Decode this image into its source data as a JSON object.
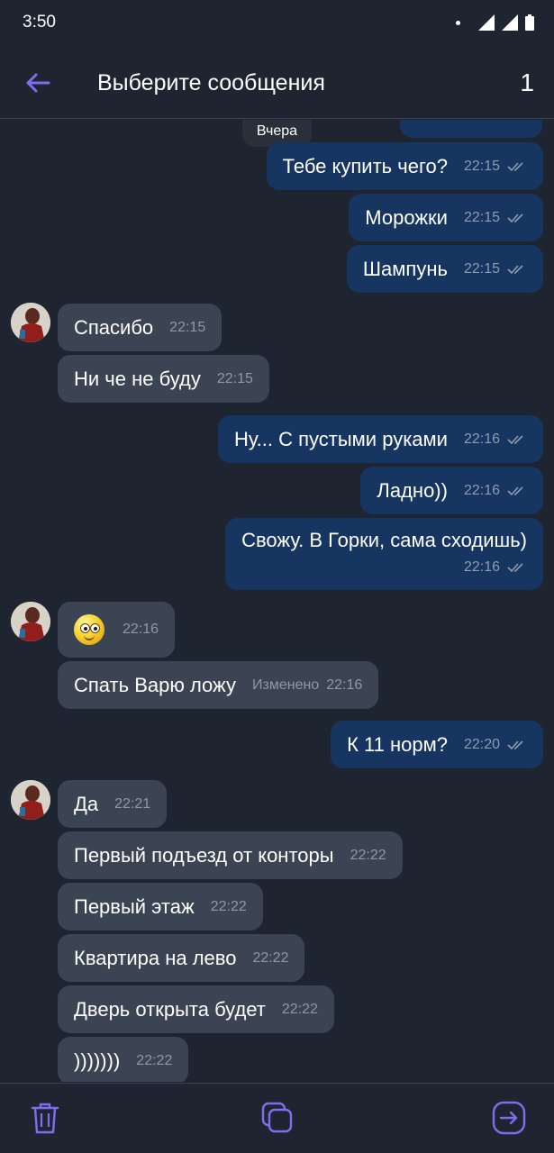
{
  "status_bar": {
    "time": "3:50"
  },
  "app_bar": {
    "title": "Выберите сообщения",
    "selected_count": "1"
  },
  "date_chip": "Вчера",
  "messages": [
    {
      "dir": "out",
      "text": "Тебе купить чего?",
      "time": "22:15"
    },
    {
      "dir": "out",
      "text": "Морожки",
      "time": "22:15"
    },
    {
      "dir": "out",
      "text": "Шампунь",
      "time": "22:15"
    },
    {
      "dir": "in",
      "text": "Спасибо",
      "time": "22:15"
    },
    {
      "dir": "in",
      "text": "Ни че не буду",
      "time": "22:15"
    },
    {
      "dir": "out",
      "text": "Ну... С пустыми руками",
      "time": "22:16"
    },
    {
      "dir": "out",
      "text": "Ладно))",
      "time": "22:16"
    },
    {
      "dir": "out",
      "text": "Свожу. В Горки, сама сходишь)",
      "time": "22:16"
    },
    {
      "dir": "in",
      "emoji": "smiley",
      "time": "22:16"
    },
    {
      "dir": "in",
      "text": "Спать Варю ложу",
      "edited": "Изменено",
      "time": "22:16"
    },
    {
      "dir": "out",
      "text": "К 11 норм?",
      "time": "22:20"
    },
    {
      "dir": "in",
      "text": "Да",
      "time": "22:21"
    },
    {
      "dir": "in",
      "text": "Первый подъезд от конторы",
      "time": "22:22"
    },
    {
      "dir": "in",
      "text": "Первый этаж",
      "time": "22:22"
    },
    {
      "dir": "in",
      "text": "Квартира на лево",
      "time": "22:22"
    },
    {
      "dir": "in",
      "text": "Дверь открыта будет",
      "time": "22:22"
    },
    {
      "dir": "in",
      "text": ")))))))",
      "time": "22:22"
    }
  ],
  "colors": {
    "accent": "#7b6ff0",
    "outgoing_bubble": "#163560",
    "incoming_bubble": "#3a4453",
    "background": "#1f2530"
  },
  "bottom_bar": {
    "icons": [
      "trash-icon",
      "copy-icon",
      "forward-icon"
    ]
  }
}
